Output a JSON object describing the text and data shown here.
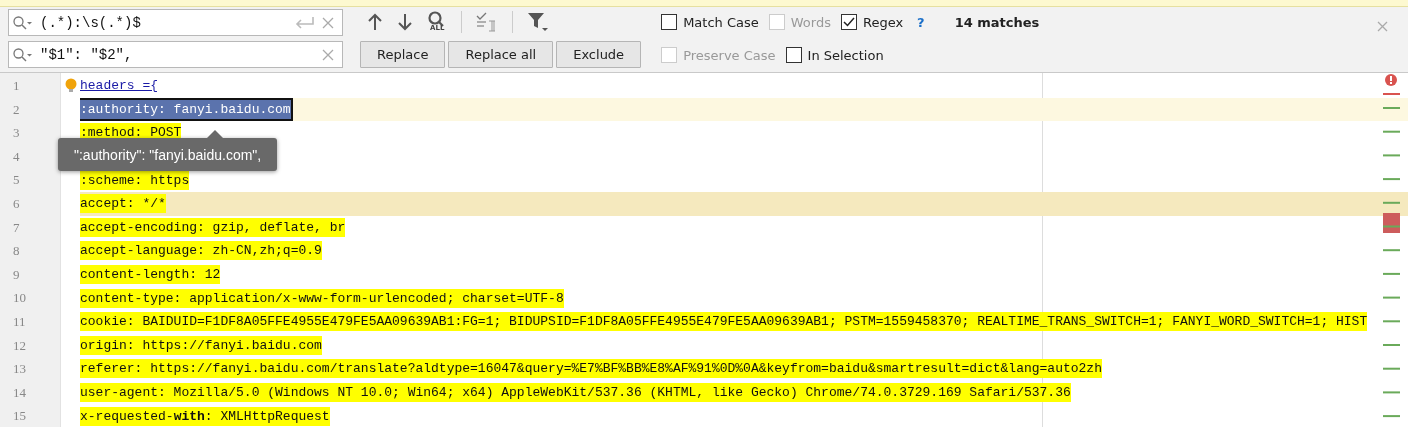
{
  "search": {
    "value": "(.*):\\s(.*)$"
  },
  "replace": {
    "value": "\"$1\": \"$2\","
  },
  "toolbar": {
    "find_all_badge": "ALL"
  },
  "options": [
    {
      "label": "Match Case",
      "checked": false,
      "disabled": false
    },
    {
      "label": "Words",
      "checked": false,
      "disabled": true
    },
    {
      "label": "Regex",
      "checked": true,
      "disabled": false
    }
  ],
  "help": "?",
  "match_count": "14 matches",
  "buttons": [
    "Replace",
    "Replace all",
    "Exclude"
  ],
  "replace_options": [
    {
      "label": "Preserve Case",
      "checked": false,
      "disabled": true
    },
    {
      "label": "In Selection",
      "checked": false,
      "disabled": false
    }
  ],
  "editor": {
    "lines": [
      {
        "number": "1",
        "kind": "link",
        "text": "headers ={",
        "match": false,
        "selected": false,
        "current": false,
        "marked": false
      },
      {
        "number": "2",
        "kind": "code",
        "text": ":authority: fanyi.baidu.com",
        "match": true,
        "selected": true,
        "current": true,
        "marked": false
      },
      {
        "number": "3",
        "kind": "code",
        "text": ":method: POST",
        "match": true,
        "selected": false,
        "current": false,
        "marked": false
      },
      {
        "number": "4"
      },
      {
        "number": "5",
        "kind": "code",
        "text": ":scheme: https",
        "match": true,
        "selected": false,
        "current": false,
        "marked": false
      },
      {
        "number": "6",
        "kind": "code",
        "text": "accept: */*",
        "match": true,
        "selected": false,
        "current": false,
        "marked": true
      },
      {
        "number": "7",
        "kind": "code",
        "text": "accept-encoding: gzip, deflate, br",
        "match": true,
        "selected": false,
        "current": false,
        "marked": false
      },
      {
        "number": "8",
        "kind": "code",
        "text": "accept-language: zh-CN,zh;q=0.9",
        "match": true,
        "selected": false,
        "current": false,
        "marked": false
      },
      {
        "number": "9",
        "kind": "code",
        "text": "content-length: 12",
        "match": true,
        "selected": false,
        "current": false,
        "marked": false
      },
      {
        "number": "10",
        "kind": "code",
        "text": "content-type: application/x-www-form-urlencoded; charset=UTF-8",
        "match": true,
        "selected": false,
        "current": false,
        "marked": false
      },
      {
        "number": "11",
        "kind": "code",
        "text": "cookie: BAIDUID=F1DF8A05FFE4955E479FE5AA09639AB1:FG=1; BIDUPSID=F1DF8A05FFE4955E479FE5AA09639AB1; PSTM=1559458370; REALTIME_TRANS_SWITCH=1; FANYI_WORD_SWITCH=1; HIST",
        "match": true,
        "selected": false,
        "current": false,
        "marked": false
      },
      {
        "number": "12",
        "kind": "code",
        "text": "origin: https://fanyi.baidu.com",
        "match": true,
        "selected": false,
        "current": false,
        "marked": false
      },
      {
        "number": "13",
        "kind": "code",
        "text": "referer: https://fanyi.baidu.com/translate?aldtype=16047&query=%E7%BF%BB%E8%AF%91%0D%0A&keyfrom=baidu&smartresult=dict&lang=auto2zh",
        "match": true,
        "selected": false,
        "current": false,
        "marked": false
      },
      {
        "number": "14",
        "kind": "code",
        "text": "user-agent: Mozilla/5.0 (Windows NT 10.0; Win64; x64) AppleWebKit/537.36 (KHTML, like Gecko) Chrome/74.0.3729.169 Safari/537.36",
        "match": true,
        "selected": false,
        "current": false,
        "marked": false
      },
      {
        "number": "15",
        "kind": "rich",
        "text": "x-requested-**with**: XMLHttpRequest",
        "match": true,
        "selected": false,
        "current": false,
        "marked": false
      }
    ]
  },
  "tooltip": {
    "text": "\":authority\": \"fanyi.baidu.com\","
  }
}
